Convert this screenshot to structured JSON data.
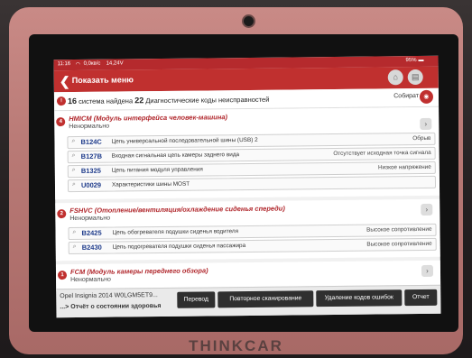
{
  "status_bar": {
    "time": "11:16",
    "net": "0,0кв/с",
    "battery_voltage": "14,24V",
    "battery": "95%"
  },
  "header": {
    "back_icon": "back-arrow-icon",
    "title": "Показать меню"
  },
  "summary": {
    "count": "16",
    "text_a": "система найдена",
    "dtc_count": "22",
    "text_b": "Диагностические коды неисправностей",
    "collect_label": "Собират"
  },
  "systems": [
    {
      "index": "4",
      "name": "HMICM (Модуль интерфейса человек-машина)",
      "state": "Ненормально",
      "codes": [
        {
          "code": "B124C",
          "desc": "Цепь универсальной последовательной шины (USB) 2",
          "status": "Обрыв"
        },
        {
          "code": "B127B",
          "desc": "Входная сигнальная цепь камеры заднего вида",
          "status": "Отсутствует исходная точка сигнала"
        },
        {
          "code": "B1325",
          "desc": "Цепь питания модуля управления",
          "status": "Низкое напряжение"
        },
        {
          "code": "U0029",
          "desc": "Характеристики шины MOST",
          "status": ""
        }
      ]
    },
    {
      "index": "2",
      "name": "FSHVC (Отопление/вентиляция/охлаждение сиденья спереди)",
      "state": "Ненормально",
      "codes": [
        {
          "code": "B2425",
          "desc": "Цепь обогревателя подушки сиденья водителя",
          "status": "Высокое сопротивление"
        },
        {
          "code": "B2430",
          "desc": "Цепь подогревателя подушки сиденья пассажира",
          "status": "Высокое сопротивление"
        }
      ]
    },
    {
      "index": "1",
      "name": "FCM (Модуль камеры переднего обзора)",
      "state": "Ненормально",
      "codes": []
    }
  ],
  "footer": {
    "vehicle": "Opel  Insignia 2014  W0LGM5ET9...",
    "report_link": "...> Отчёт о состоянии здоровья",
    "buttons": [
      "Перевод",
      "Повторное сканирование",
      "Удаление кодов ошибок",
      "Отчет"
    ]
  },
  "device": {
    "brand": "THINKCAR"
  }
}
